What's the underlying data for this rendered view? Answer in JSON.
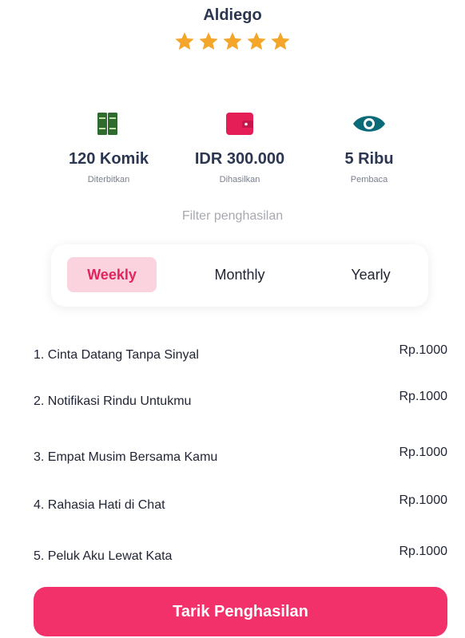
{
  "profile": {
    "name": "Aldiego",
    "rating": 5,
    "star_color": "#f4a62a"
  },
  "stats": [
    {
      "icon": "books-icon",
      "value": "120 Komik",
      "caption": "Diterbitkan",
      "color": "#2f6b2f"
    },
    {
      "icon": "wallet-icon",
      "value": "IDR 300.000",
      "caption": "Dihasilkan",
      "color": "#e51e57"
    },
    {
      "icon": "eye-icon",
      "value": "5 Ribu",
      "caption": "Pembaca",
      "color": "#0b6a78"
    }
  ],
  "filter": {
    "label": "Filter penghasilan",
    "tabs": [
      {
        "label": "Weekly",
        "active": true
      },
      {
        "label": "Monthly",
        "active": false
      },
      {
        "label": "Yearly",
        "active": false
      }
    ]
  },
  "earnings": [
    {
      "title": "1. Cinta Datang Tanpa Sinyal",
      "amount": "Rp.1000"
    },
    {
      "title": "2. Notifikasi Rindu Untukmu",
      "amount": "Rp.1000"
    },
    {
      "title": "3. Empat Musim Bersama Kamu",
      "amount": "Rp.1000"
    },
    {
      "title": "4. Rahasia Hati di Chat",
      "amount": "Rp.1000"
    },
    {
      "title": "5. Peluk Aku Lewat Kata",
      "amount": "Rp.1000"
    }
  ],
  "withdraw_button": {
    "label": "Tarik Penghasilan",
    "color": "#f2316b"
  }
}
